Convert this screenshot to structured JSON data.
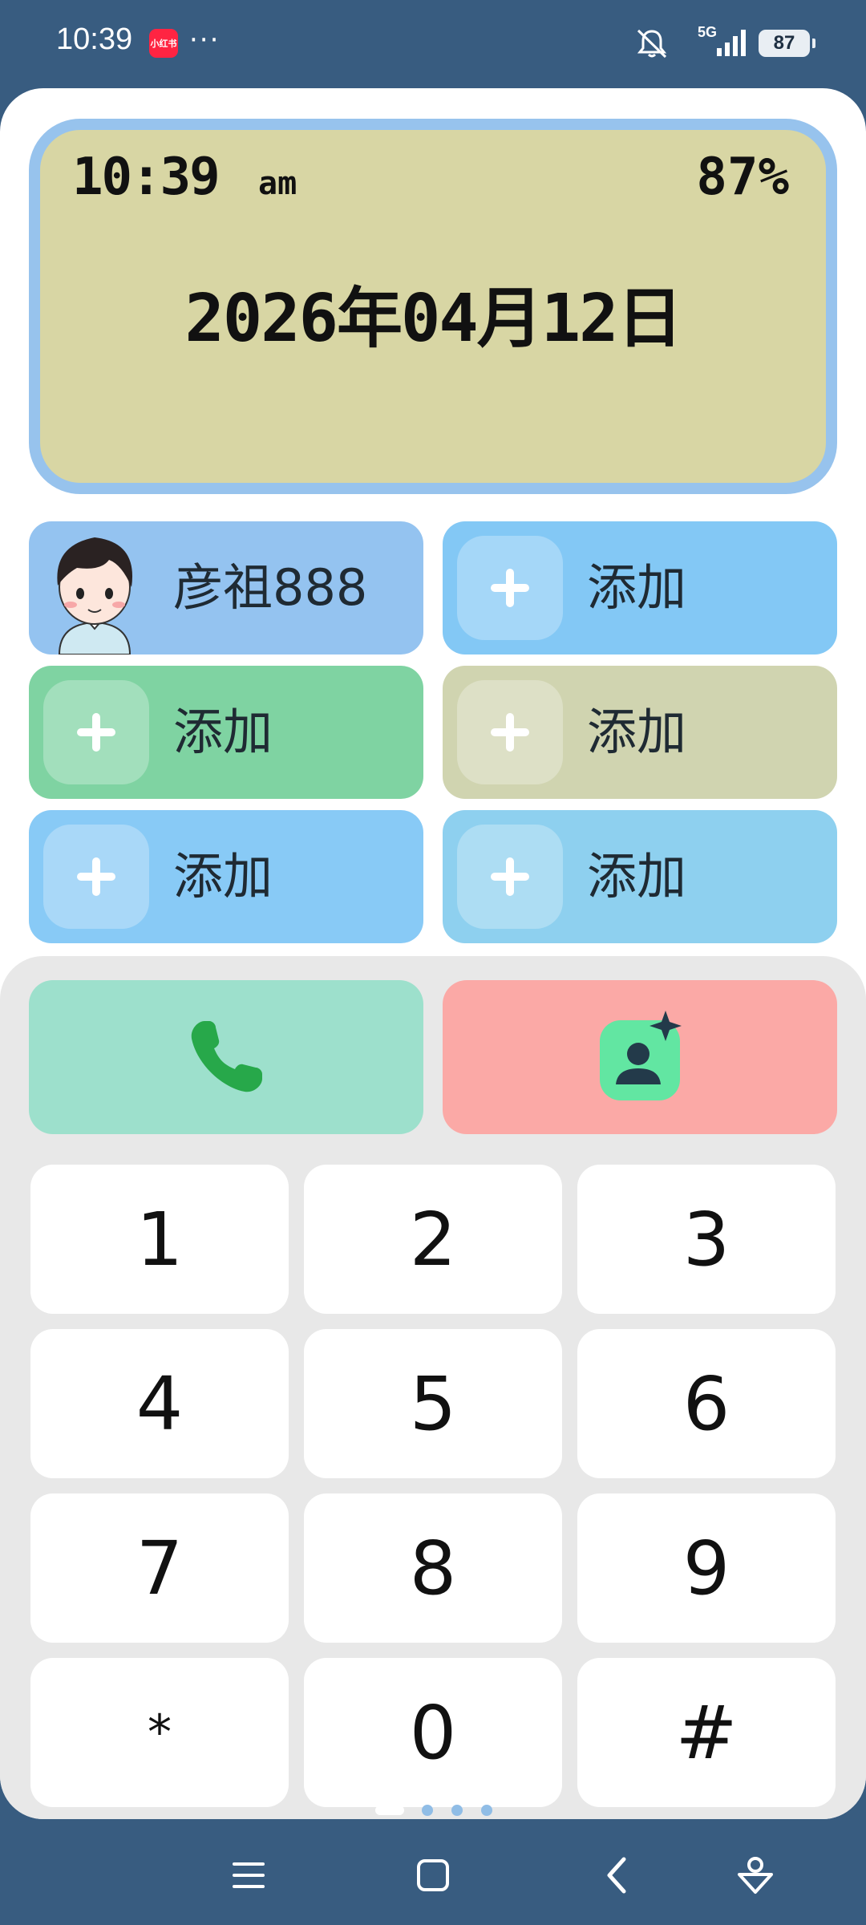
{
  "status_bar": {
    "time": "10:39",
    "app_badge": "小红书",
    "more": "···",
    "network": "5G",
    "battery": "87"
  },
  "lcd": {
    "time": "10:39",
    "ampm": "am",
    "battery": "87%",
    "date": "2026年04月12日"
  },
  "contacts": [
    {
      "label": "彦祖888",
      "color": "#94c3f0",
      "avatar": true
    },
    {
      "label": "添加",
      "color": "#83c8f5",
      "avatar": false
    },
    {
      "label": "添加",
      "color": "#7fd3a2",
      "avatar": false
    },
    {
      "label": "添加",
      "color": "#d0d4b0",
      "avatar": false
    },
    {
      "label": "添加",
      "color": "#88caf6",
      "avatar": false
    },
    {
      "label": "添加",
      "color": "#8ed0ef",
      "avatar": false
    }
  ],
  "actions": {
    "call_icon": "phone-icon",
    "contact_icon": "add-contact-icon"
  },
  "keypad": [
    "1",
    "2",
    "3",
    "4",
    "5",
    "6",
    "7",
    "8",
    "9",
    "*",
    "0",
    "#"
  ],
  "nav": [
    "menu-icon",
    "home-icon",
    "back-icon",
    "assistant-icon"
  ]
}
